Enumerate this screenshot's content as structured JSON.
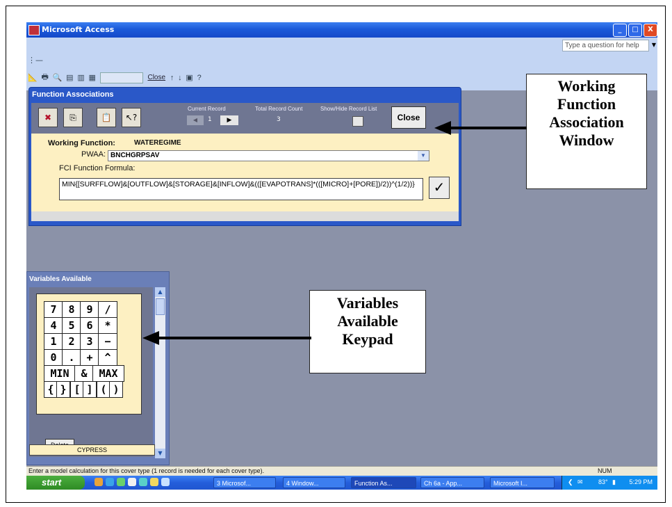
{
  "window": {
    "title": "Microsoft Access",
    "min": "_",
    "max": "□",
    "close": "X"
  },
  "help": {
    "placeholder": "Type a question for help"
  },
  "toolbar": {
    "close_label": "Close"
  },
  "function_associations": {
    "title": "Function Associations",
    "current_record_label": "Current Record",
    "total_count_label": "Total Record Count",
    "showhide_label": "Show/Hide Record List",
    "current_record": "1",
    "total_count": "3",
    "close_button": "Close",
    "working_function_label": "Working Function:",
    "working_function_value": "WATEREGIME",
    "pwaa_label": "PWAA:",
    "pwaa_value": "BNCHGRPSAV",
    "formula_label": "FCI Function Formula:",
    "formula_value": "MIN{[SURFFLOW]&[OUTFLOW]&[STORAGE]&[INFLOW]&(([EVAPOTRANS]*(([MICRO]+[PORE])/2))^(1/2))}"
  },
  "variables_available": {
    "title": "Variables Available",
    "keys": [
      [
        "7",
        "8",
        "9",
        "/"
      ],
      [
        "4",
        "5",
        "6",
        "*"
      ],
      [
        "1",
        "2",
        "3",
        "−"
      ],
      [
        "0",
        ".",
        "+",
        "^"
      ],
      [
        "MIN",
        "&",
        "MAX"
      ],
      [
        "{",
        "}",
        "[",
        "]",
        "(",
        ")"
      ]
    ],
    "delete_label": "Delete",
    "selected_variable": "CYPRESS"
  },
  "status": {
    "message": "Enter a model calculation for this cover type (1 record is needed for each cover type).",
    "num": "NUM"
  },
  "taskbar": {
    "start": "start",
    "items": [
      "3 Microsof...",
      "4 Window...",
      "Function As...",
      "Ch 6a - App...",
      "Microsoft I..."
    ],
    "temp": "83°",
    "clock": "5:29 PM"
  },
  "annotations": {
    "working_function_window": [
      "Working",
      "Function",
      "Association",
      "Window"
    ],
    "variables_keypad": [
      "Variables",
      "Available",
      "Keypad"
    ]
  }
}
